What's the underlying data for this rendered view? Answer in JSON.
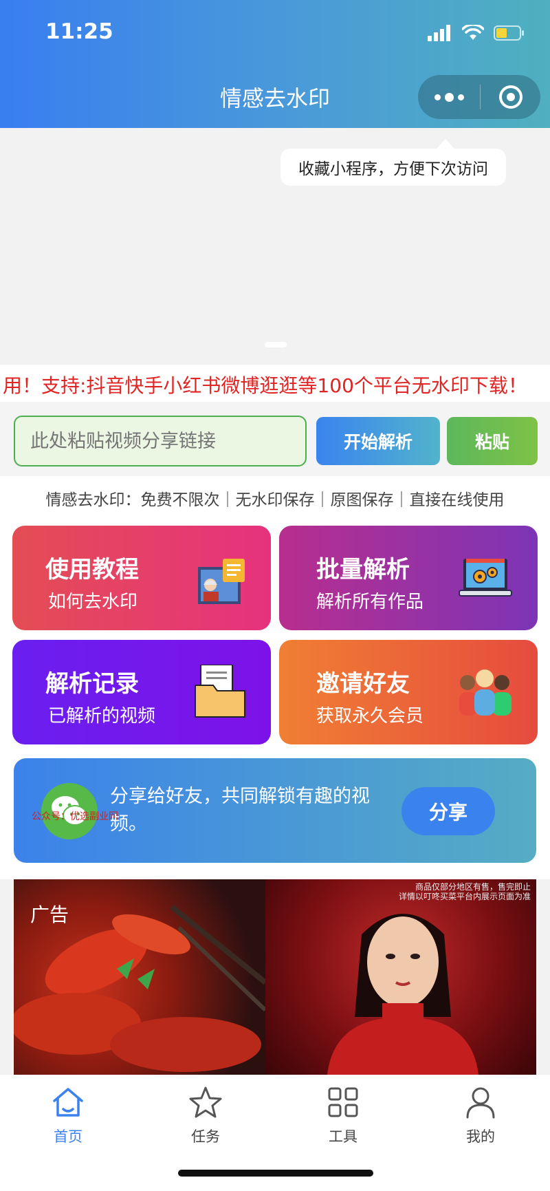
{
  "status": {
    "time": "11:25"
  },
  "header": {
    "title": "情感去水印"
  },
  "tooltip": "收藏小程序，方便下次访问",
  "marquee": "用！支持:抖音快手小红书微博逛逛等100个平台无水印下载！",
  "search": {
    "placeholder": "此处粘贴视频分享链接",
    "value": ""
  },
  "buttons": {
    "parse": "开始解析",
    "paste": "粘贴"
  },
  "features": "情感去水印：免费不限次｜无水印保存｜原图保存｜直接在线使用",
  "cards": [
    {
      "title": "使用教程",
      "subtitle": "如何去水印"
    },
    {
      "title": "批量解析",
      "subtitle": "解析所有作品"
    },
    {
      "title": "解析记录",
      "subtitle": "已解析的视频"
    },
    {
      "title": "邀请好友",
      "subtitle": "获取永久会员"
    }
  ],
  "share": {
    "text": "分享给好友，共同解锁有趣的视频。",
    "button": "分享",
    "watermark": "公众号：优选副业网"
  },
  "ad": {
    "label": "广告",
    "note_line1": "商品仅部分地区有售，售完即止",
    "note_line2": "详情以叮咚买菜平台内展示页面为准"
  },
  "tabbar": [
    {
      "label": "首页",
      "icon": "home-icon",
      "active": true
    },
    {
      "label": "任务",
      "icon": "star-icon",
      "active": false
    },
    {
      "label": "工具",
      "icon": "grid-icon",
      "active": false
    },
    {
      "label": "我的",
      "icon": "user-icon",
      "active": false
    }
  ],
  "colors": {
    "accent": "#3a82ee",
    "marquee_text": "#e02424",
    "paste_green": "#5cb85c"
  }
}
